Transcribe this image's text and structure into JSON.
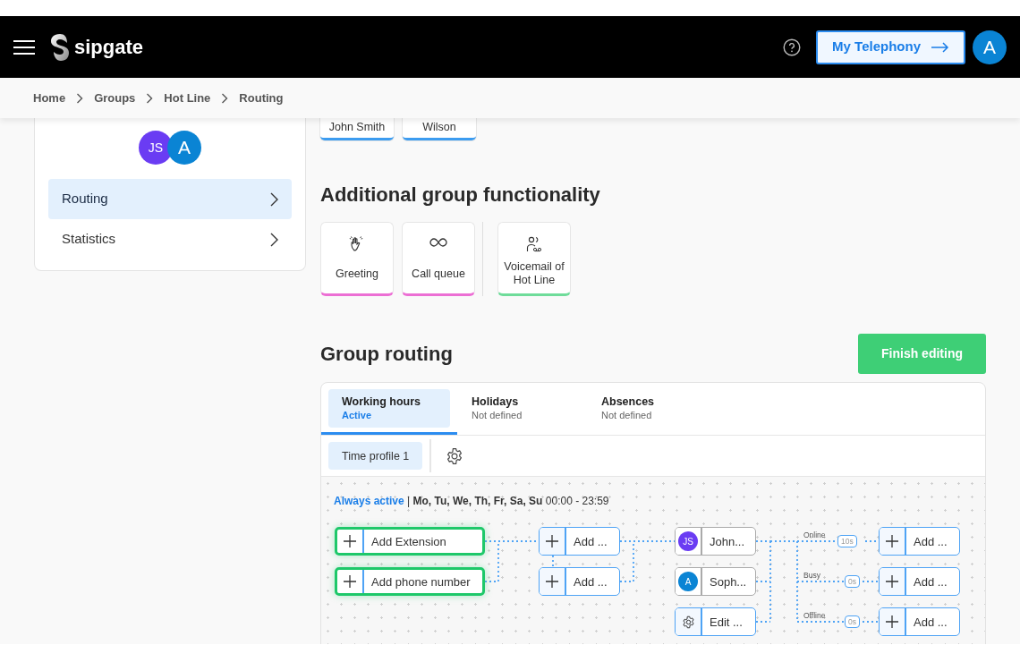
{
  "header": {
    "logo": "sipgate",
    "cta": "My Telephony",
    "avatar": "A"
  },
  "breadcrumb": [
    "Home",
    "Groups",
    "Hot Line",
    "Routing"
  ],
  "sidebar": {
    "avatars": [
      {
        "initials": "JS",
        "color": "#6a3cf3"
      },
      {
        "initials": "A",
        "color": "#0a84d4"
      }
    ],
    "items": [
      {
        "label": "Routing",
        "selected": true
      },
      {
        "label": "Statistics",
        "selected": false
      }
    ]
  },
  "members": [
    {
      "name": "John Smith",
      "color": "#3c9cf0"
    },
    {
      "name": "Wilson",
      "color": "#3c9cf0"
    }
  ],
  "functionality": {
    "title": "Additional group functionality",
    "groups": [
      [
        {
          "kind": "greeting",
          "label": "Greeting",
          "color": "#ec6fd4"
        },
        {
          "kind": "queue",
          "label": "Call queue",
          "color": "#ec6fd4"
        }
      ],
      [
        {
          "kind": "voicemail",
          "label": "Voicemail of Hot Line",
          "color": "#6fdc9a"
        }
      ]
    ]
  },
  "routing": {
    "title": "Group routing",
    "finish_button": "Finish editing",
    "tabs": [
      {
        "label": "Working hours",
        "status": "Active",
        "selected": true
      },
      {
        "label": "Holidays",
        "status": "Not defined",
        "selected": false
      },
      {
        "label": "Absences",
        "status": "Not defined",
        "selected": false
      }
    ],
    "time_profiles": [
      {
        "label": "Time profile 1",
        "selected": true
      }
    ],
    "schedule": {
      "status": "Always active",
      "separator": "|",
      "days": "Mo, Tu, We, Th, Fr, Sa, Su",
      "hours": "00:00 - 23:59"
    },
    "columns": [
      {
        "nodes": [
          {
            "kind": "entry",
            "label": "Add Extension"
          },
          {
            "kind": "entry",
            "label": "Add phone number"
          }
        ]
      },
      {
        "nodes": [
          {
            "kind": "add",
            "label": "Add ..."
          },
          {
            "kind": "add",
            "label": "Add ..."
          }
        ]
      },
      {
        "nodes": [
          {
            "kind": "member",
            "label": "John...",
            "initials": "JS",
            "color": "#6a3cf3"
          },
          {
            "kind": "member",
            "label": "Soph...",
            "initials": "A",
            "color": "#0a84d4"
          },
          {
            "kind": "settings",
            "label": "Edit ..."
          }
        ]
      }
    ],
    "conditions": [
      {
        "label": "Online",
        "delay": "10s"
      },
      {
        "label": "Busy",
        "delay": "0s"
      },
      {
        "label": "Offline",
        "delay": "0s"
      }
    ],
    "targets": [
      {
        "kind": "add",
        "label": "Add ..."
      },
      {
        "kind": "add",
        "label": "Add ..."
      },
      {
        "kind": "add",
        "label": "Add ..."
      }
    ]
  }
}
